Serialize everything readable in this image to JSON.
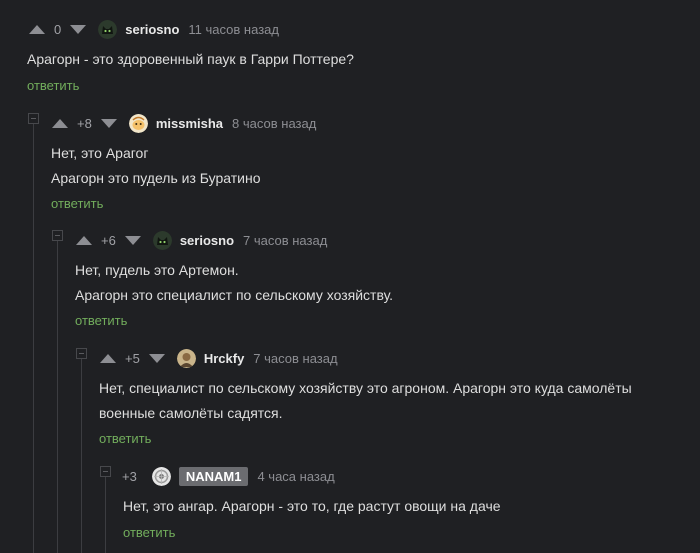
{
  "comments": [
    {
      "rating": "0",
      "username": "seriosno",
      "time": "11 часов назад",
      "lines": [
        "Арагорн - это здоровенный паук в Гарри Поттере?"
      ],
      "reply": "ответить",
      "avatar": "cat-avatar"
    },
    {
      "rating": "+8",
      "username": "missmisha",
      "time": "8 часов назад",
      "lines": [
        "Нет, это Арагог",
        "Арагорн это пудель из Буратино"
      ],
      "reply": "ответить",
      "avatar": "cartoon-avatar"
    },
    {
      "rating": "+6",
      "username": "seriosno",
      "time": "7 часов назад",
      "lines": [
        "Нет, пудель это Артемон.",
        "Арагорн это специалист по сельскому хозяйству."
      ],
      "reply": "ответить",
      "avatar": "cat-avatar"
    },
    {
      "rating": "+5",
      "username": "Hrckfy",
      "time": "7 часов назад",
      "lines": [
        "Нет, специалист по сельскому хозяйству это агроном. Арагорн это куда самолёты",
        "военные самолёты садятся."
      ],
      "reply": "ответить",
      "avatar": "person-avatar"
    },
    {
      "rating": "+3",
      "username": "NANAM1",
      "time": "4 часа назад",
      "lines": [
        "Нет, это ангар. Арагорн - это то, где растут овощи на даче"
      ],
      "reply": "ответить",
      "avatar": "pattern-avatar"
    }
  ],
  "colors": {
    "background": "#1f2023",
    "reply_link": "#72ad5c",
    "vote_arrow": "#8d8e93",
    "author_badge": "#6b6c70"
  }
}
